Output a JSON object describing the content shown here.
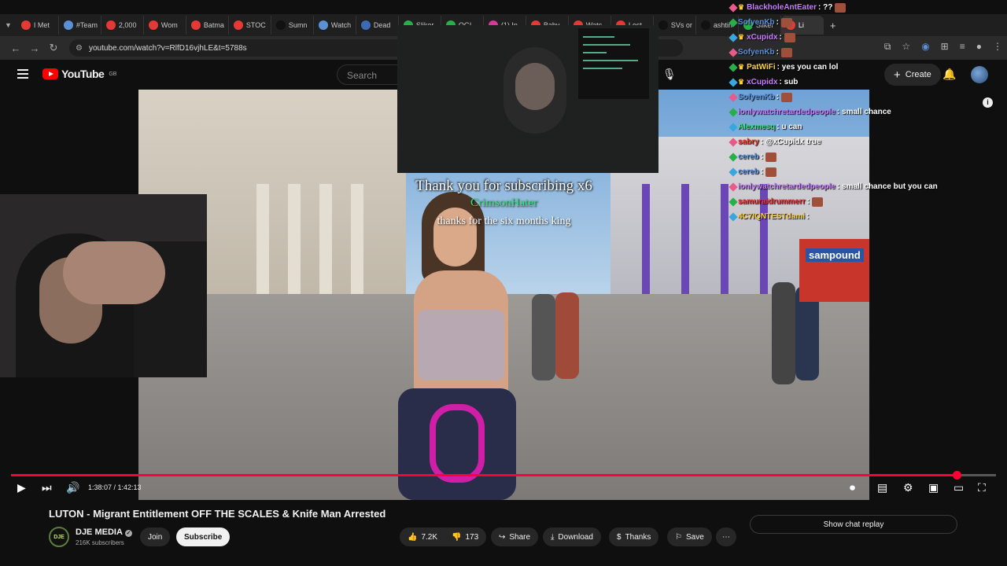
{
  "browser": {
    "tabs": [
      {
        "label": "I Met",
        "color": "#e53935"
      },
      {
        "label": "#Team",
        "color": "#5b8fd6"
      },
      {
        "label": "2,000",
        "color": "#e53935"
      },
      {
        "label": "Wom",
        "color": "#e53935"
      },
      {
        "label": "Batma",
        "color": "#e53935"
      },
      {
        "label": "STOC",
        "color": "#e53935"
      },
      {
        "label": "Sumn",
        "color": "#111111"
      },
      {
        "label": "Watch",
        "color": "#5b8fd6"
      },
      {
        "label": "Dead",
        "color": "#3b6bb5"
      },
      {
        "label": "Sliker",
        "color": "#27b04a"
      },
      {
        "label": "OGL",
        "color": "#27b04a"
      },
      {
        "label": "(1) In",
        "color": "#d6399b"
      },
      {
        "label": "Baby",
        "color": "#e53935"
      },
      {
        "label": "Watc",
        "color": "#e53935"
      },
      {
        "label": "Lost",
        "color": "#e53935"
      },
      {
        "label": "SVs or",
        "color": "#111111"
      },
      {
        "label": "ashtin",
        "color": "#111111"
      },
      {
        "label": "Sliker",
        "color": "#27b04a"
      },
      {
        "label": "Li",
        "color": "#e53935"
      }
    ],
    "url": "youtube.com/watch?v=RlfD16vjhLE&t=5788s"
  },
  "youtube": {
    "logo_text": "YouTube",
    "region": "GB",
    "search_placeholder": "Search",
    "create_label": "Create"
  },
  "video": {
    "alert_title": "Thank you for subscribing x6",
    "alert_name": "CrimsonHater",
    "alert_message": "thanks for the six months king",
    "shop_sign": "sampound",
    "time_display": "1:38:07 / 1:42:13",
    "progress": 0.96,
    "title": "LUTON - Migrant Entitlement OFF THE SCALES & Knife Man Arrested"
  },
  "channel": {
    "avatar_text": "DJE",
    "name": "DJE MEDIA",
    "subscribers": "216K subscribers",
    "join_label": "Join",
    "subscribe_label": "Subscribe"
  },
  "actions": {
    "likes": "7.2K",
    "dislikes": "173",
    "share": "Share",
    "download": "Download",
    "thanks": "Thanks",
    "save": "Save"
  },
  "chat_replay_label": "Show chat replay",
  "chat": [
    {
      "user": "BlackholeAntEater",
      "msg": ": ??",
      "color": "#c77dff",
      "crown": true,
      "emote": true
    },
    {
      "user": "SofyenKb",
      "msg": ":",
      "color": "#5b8fd6",
      "crown": false,
      "emote": true
    },
    {
      "user": "xCupidx",
      "msg": ":",
      "color": "#c77dff",
      "crown": true,
      "emote": true
    },
    {
      "user": "SofyenKb",
      "msg": ":",
      "color": "#5b8fd6",
      "crown": false,
      "emote": true
    },
    {
      "user": "PatWiFi",
      "msg": ": yes you can lol",
      "color": "#ffd23f",
      "crown": true,
      "emote": false
    },
    {
      "user": "xCupidx",
      "msg": ": sub",
      "color": "#c77dff",
      "crown": true,
      "emote": false
    },
    {
      "user": "SofyenKb",
      "msg": ":",
      "color": "#5b8fd6",
      "crown": false,
      "emote": true
    },
    {
      "user": "ionlywatchretardedpeople",
      "msg": ": small chance",
      "color": "#c77dff",
      "crown": false,
      "emote": false
    },
    {
      "user": "Alexmesq",
      "msg": ": u can",
      "color": "#2ee87a",
      "crown": false,
      "emote": false
    },
    {
      "user": "sabry",
      "msg": ": @xCupidx true",
      "color": "#e53935",
      "crown": false,
      "emote": false
    },
    {
      "user": "cereb",
      "msg": ":",
      "color": "#5b8fd6",
      "crown": false,
      "emote": true
    },
    {
      "user": "cereb",
      "msg": ":",
      "color": "#5b8fd6",
      "crown": false,
      "emote": true
    },
    {
      "user": "ionlywatchretardedpeople",
      "msg": ": small chance but you can",
      "color": "#c77dff",
      "crown": false,
      "emote": false
    },
    {
      "user": "samuraidrummerr",
      "msg": ":",
      "color": "#e53935",
      "crown": false,
      "emote": true
    },
    {
      "user": "4C7IQNTESTdami",
      "msg": ":",
      "color": "#ffd23f",
      "crown": false,
      "emote": false
    }
  ]
}
